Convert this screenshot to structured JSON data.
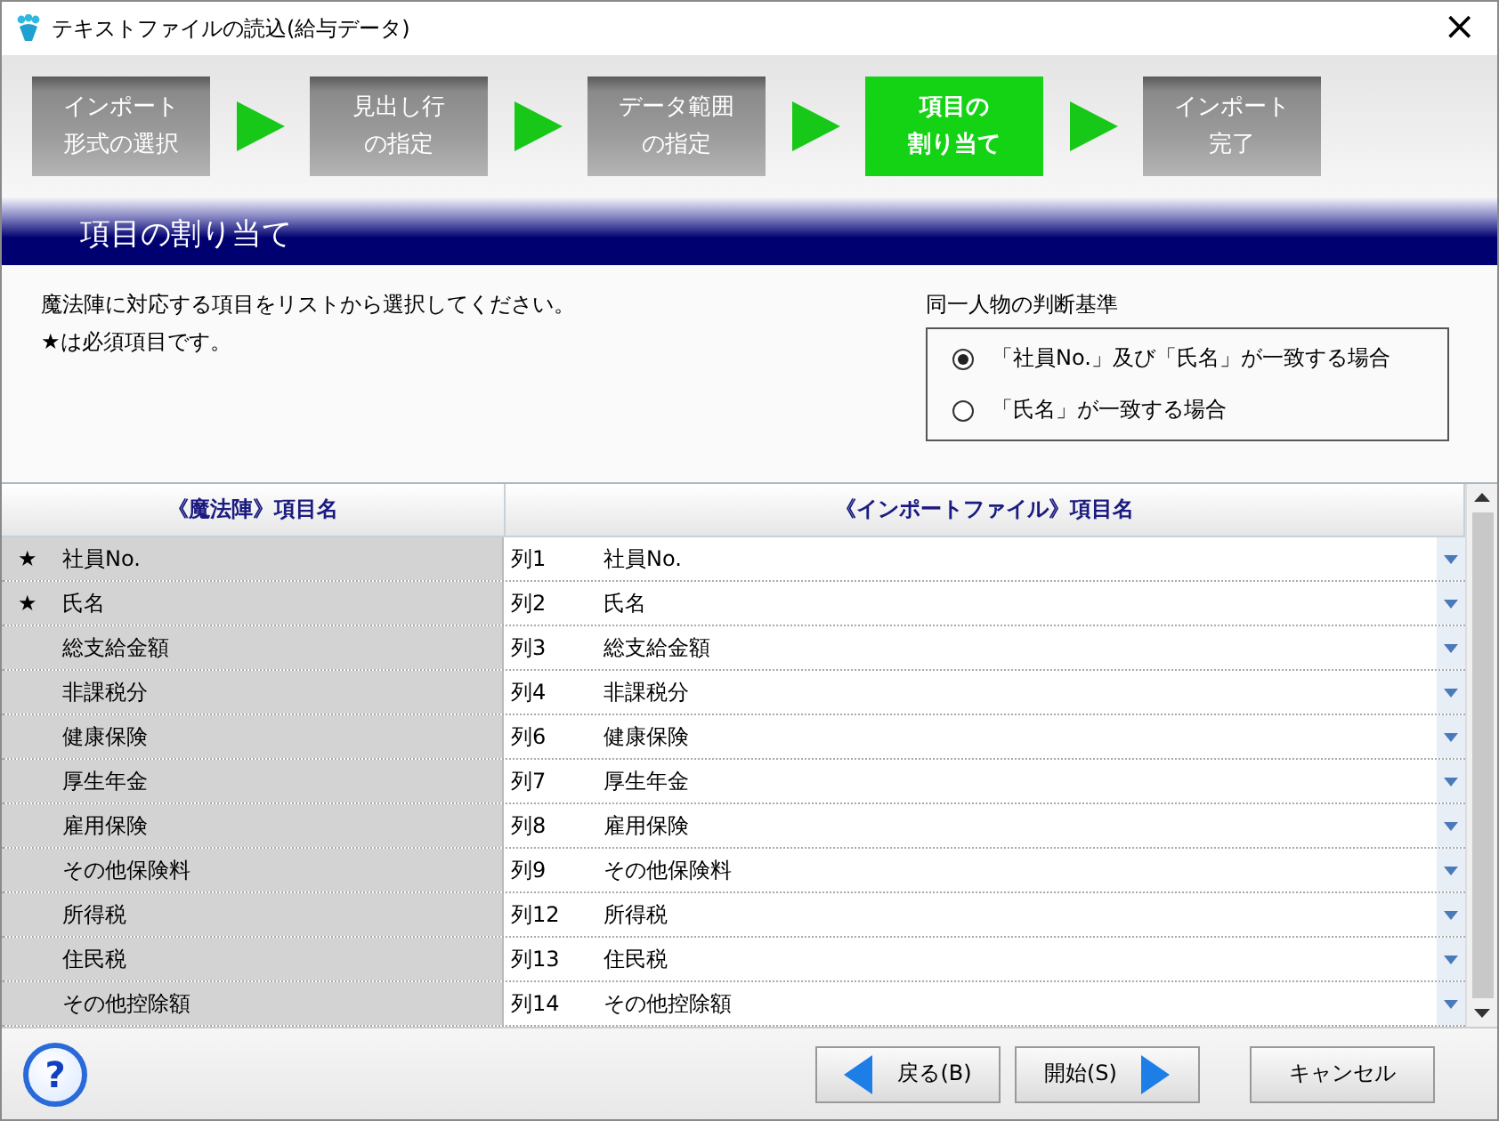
{
  "window": {
    "title": "テキストファイルの読込(給与データ)",
    "close": "×"
  },
  "steps": [
    {
      "lines": [
        "インポート",
        "形式の選択"
      ],
      "selected": false
    },
    {
      "lines": [
        "見出し行",
        "の指定"
      ],
      "selected": false
    },
    {
      "lines": [
        "データ範囲",
        "の指定"
      ],
      "selected": false
    },
    {
      "lines": [
        "項目の",
        "割り当て"
      ],
      "selected": true
    },
    {
      "lines": [
        "インポート",
        "完了"
      ],
      "selected": false
    }
  ],
  "section_title": "項目の割り当て",
  "instructions": [
    "魔法陣に対応する項目をリストから選択してください。",
    "★は必須項目です。"
  ],
  "match_criteria": {
    "title": "同一人物の判断基準",
    "options": [
      {
        "label": "「社員No.」及び「氏名」が一致する場合",
        "selected": true
      },
      {
        "label": "「氏名」が一致する場合",
        "selected": false
      }
    ]
  },
  "table": {
    "columns": [
      "《魔法陣》項目名",
      "《インポートファイル》項目名"
    ],
    "required_mark": "★",
    "rows": [
      {
        "required": true,
        "name": "社員No.",
        "column": "列1",
        "value": "社員No."
      },
      {
        "required": true,
        "name": "氏名",
        "column": "列2",
        "value": "氏名"
      },
      {
        "required": false,
        "name": "総支給金額",
        "column": "列3",
        "value": "総支給金額"
      },
      {
        "required": false,
        "name": "非課税分",
        "column": "列4",
        "value": "非課税分"
      },
      {
        "required": false,
        "name": "健康保険",
        "column": "列6",
        "value": "健康保険"
      },
      {
        "required": false,
        "name": "厚生年金",
        "column": "列7",
        "value": "厚生年金"
      },
      {
        "required": false,
        "name": "雇用保険",
        "column": "列8",
        "value": "雇用保険"
      },
      {
        "required": false,
        "name": "その他保険料",
        "column": "列9",
        "value": "その他保険料"
      },
      {
        "required": false,
        "name": "所得税",
        "column": "列12",
        "value": "所得税"
      },
      {
        "required": false,
        "name": "住民税",
        "column": "列13",
        "value": "住民税"
      },
      {
        "required": false,
        "name": "その他控除額",
        "column": "列14",
        "value": "その他控除額"
      }
    ]
  },
  "help_button": {
    "label": "?"
  },
  "buttons": [
    {
      "kind": "back",
      "label": "戻る(B)"
    },
    {
      "kind": "start",
      "label": "開始(S)"
    },
    {
      "kind": "cancel",
      "label": "キャンセル"
    }
  ]
}
